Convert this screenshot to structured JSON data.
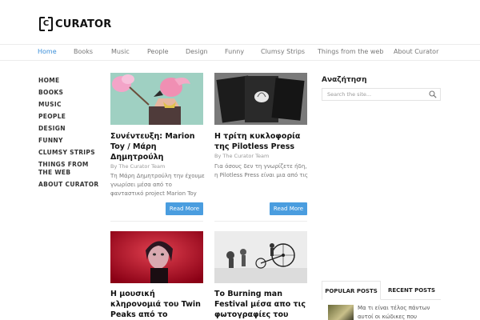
{
  "brand": {
    "mark": "C",
    "name": "CURATOR"
  },
  "nav": {
    "items": [
      {
        "label": "Home",
        "active": true
      },
      {
        "label": "Books"
      },
      {
        "label": "Music"
      },
      {
        "label": "People"
      },
      {
        "label": "Design"
      },
      {
        "label": "Funny"
      },
      {
        "label": "Clumsy Strips"
      },
      {
        "label": "Things from the web"
      },
      {
        "label": "About Curator"
      }
    ]
  },
  "sidebar": {
    "items": [
      "HOME",
      "BOOKS",
      "MUSIC",
      "PEOPLE",
      "DESIGN",
      "FUNNY",
      "CLUMSY STRIPS",
      "THINGS FROM THE WEB",
      "ABOUT CURATOR"
    ]
  },
  "posts": [
    {
      "title": "Συνέντευξη: Marion Toy / Μάρη Δημητρούλη",
      "meta": "By The Curator Team",
      "excerpt": "Τη Μάρη Δημητρούλη την έχουμε γνωρίσει μέσα από το φανταστικό project Marion Toy",
      "read_more": "Read More"
    },
    {
      "title": "Η τρίτη κυκλοφορία της Pilotless Press",
      "meta": "By The Curator Team",
      "excerpt": "Για όσους δεν τη γνωρίζετε ήδη, η Pilotless Press είναι μια από τις",
      "read_more": "Read More"
    },
    {
      "title": "Η μουσική κληρονομιά του Twin Peaks από το Pitchfork"
    },
    {
      "title": "Το Burning man Festival μέσα απο τις φωτογραφίες του"
    }
  ],
  "search": {
    "title": "Αναζήτηση",
    "placeholder": "Search the site..."
  },
  "widget_tabs": {
    "popular": "POPULAR POSTS",
    "recent": "RECENT POSTS"
  },
  "popular_posts": [
    {
      "title": "Μα τι είναι τέλος πάντων αυτοί οι κώδικες που"
    }
  ],
  "colors": {
    "accent": "#4a9ddf",
    "nav_active": "#3b8fd9"
  }
}
